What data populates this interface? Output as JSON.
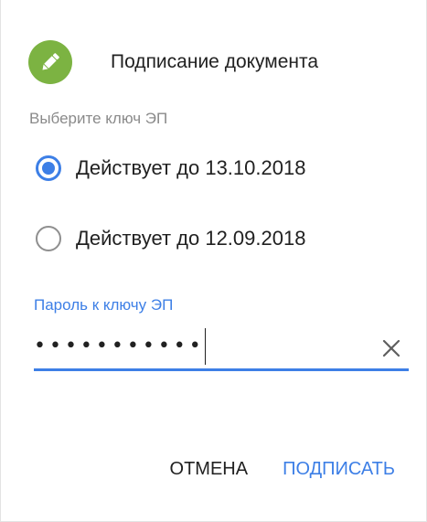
{
  "dialog": {
    "title": "Подписание документа",
    "logo_icon": "pencil-icon",
    "accent_color": "#3d7fe6",
    "logo_color": "#7cb342"
  },
  "key_select": {
    "label": "Выберите ключ ЭП",
    "options": [
      {
        "label": "Действует до 13.10.2018",
        "selected": true
      },
      {
        "label": "Действует до 12.09.2018",
        "selected": false
      }
    ]
  },
  "password": {
    "label": "Пароль к ключу ЭП",
    "masked_value": "•••••••••••",
    "clear_icon": "close-icon"
  },
  "actions": {
    "cancel_label": "ОТМЕНА",
    "sign_label": "ПОДПИСАТЬ"
  }
}
